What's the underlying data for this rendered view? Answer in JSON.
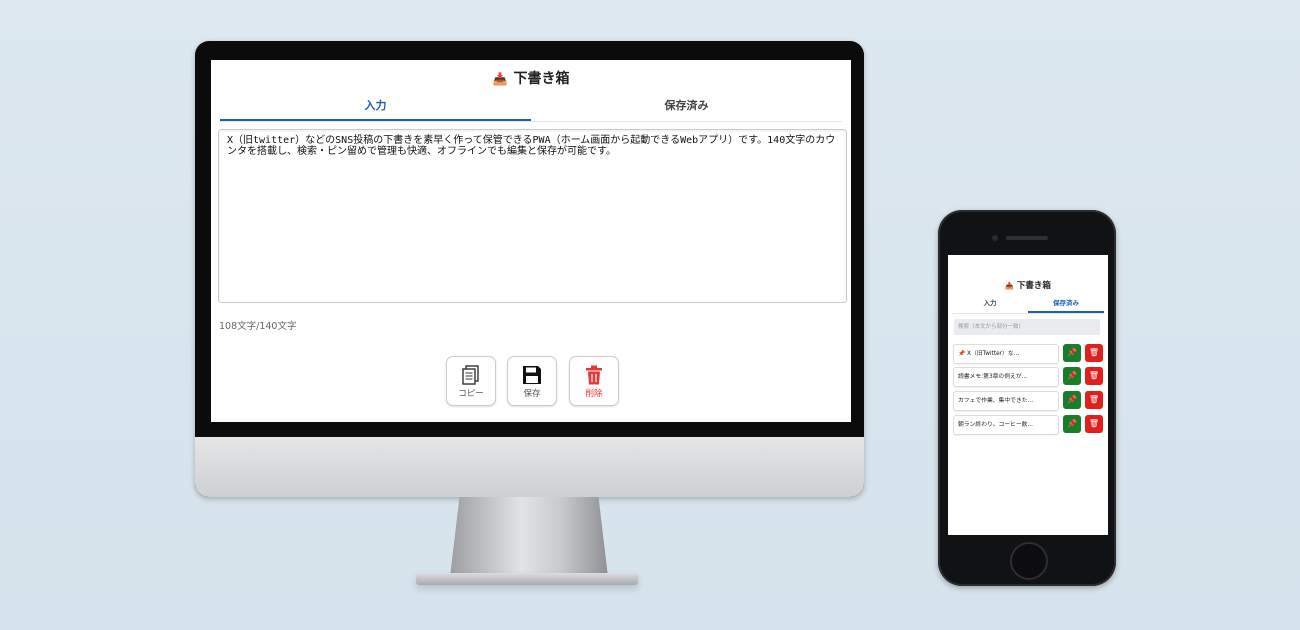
{
  "desktop": {
    "app_title": "下書き箱",
    "tabs": [
      {
        "label": "入力",
        "active": true
      },
      {
        "label": "保存済み",
        "active": false
      }
    ],
    "textarea_value": "X（旧twitter）などのSNS投稿の下書きを素早く作って保管できるPWA（ホーム画面から起動できるWebアプリ）です。140文字のカウンタを搭載し、検索・ピン留めで管理も快適、オフラインでも編集と保存が可能です。",
    "char_counter": "108文字/140文字",
    "buttons": {
      "copy": "コピー",
      "save": "保存",
      "delete": "削除"
    }
  },
  "phone": {
    "app_title": "下書き箱",
    "tabs": [
      {
        "label": "入力",
        "active": false
      },
      {
        "label": "保存済み",
        "active": true
      }
    ],
    "search_placeholder": "検索（本文から部分一致）",
    "items": [
      {
        "text": "📌 X（旧Twitter）な...",
        "pinned": true
      },
      {
        "text": "読書メモ:第3章の例えが...",
        "pinned": false
      },
      {
        "text": "カフェで作業、集中できた...",
        "pinned": false
      },
      {
        "text": "朝ラン終わり。コーヒー飲...",
        "pinned": false
      }
    ]
  },
  "colors": {
    "accent": "#1e5fb0",
    "pin_green": "#1b7d2c",
    "delete_red": "#e21f1f",
    "background": "#dde8f0"
  },
  "icons": {
    "title": "inbox-tray-icon",
    "copy": "copy-icon",
    "save": "floppy-disk-icon",
    "delete": "trash-icon",
    "pin": "pin-icon"
  }
}
